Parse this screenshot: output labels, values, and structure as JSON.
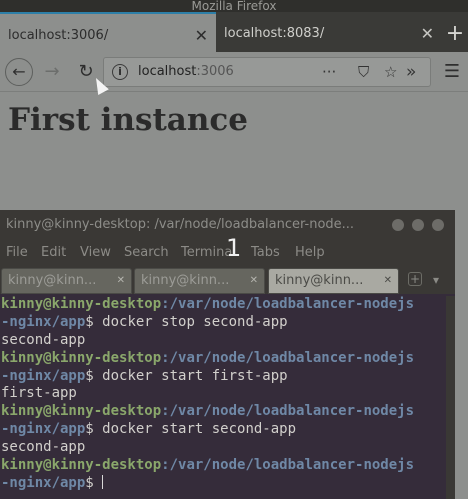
{
  "browser": {
    "window_title": "Mozilla Firefox",
    "tabs": [
      {
        "label": "localhost:3006/",
        "active": true
      },
      {
        "label": "localhost:8083/",
        "active": false
      }
    ],
    "new_tab_label": "+",
    "url_host": "localhost",
    "url_port": ":3006",
    "page_heading": "First instance"
  },
  "terminal": {
    "title": "kinny@kinny-desktop: /var/node/loadbalancer-node...",
    "menu": [
      "File",
      "Edit",
      "View",
      "Search",
      "Terminal",
      "Tabs",
      "Help"
    ],
    "workspace_number": "1",
    "tabs": [
      {
        "label": "kinny@kinn...",
        "active": false
      },
      {
        "label": "kinny@kinn...",
        "active": false
      },
      {
        "label": "kinny@kinn...",
        "active": true
      }
    ],
    "prompt_user": "kinny@kinny-desktop",
    "prompt_path_1": ":/var/node/loadbalancer-nodejs",
    "prompt_path_2": "-nginx/app",
    "prompt_symbol": "$",
    "commands": [
      {
        "cmd": " docker stop second-app",
        "output": "second-app"
      },
      {
        "cmd": " docker start first-app",
        "output": "first-app"
      },
      {
        "cmd": " docker start second-app",
        "output": "second-app"
      }
    ]
  }
}
